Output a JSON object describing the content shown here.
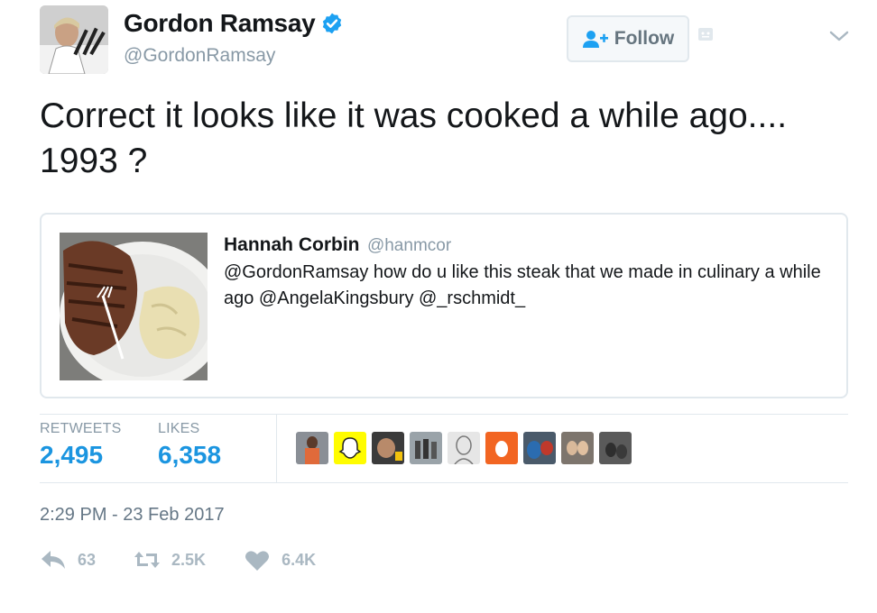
{
  "author": {
    "display_name": "Gordon Ramsay",
    "handle": "@GordonRamsay",
    "verified": true
  },
  "follow_button": {
    "label": "Follow"
  },
  "tweet": {
    "text": "Correct it looks like it was cooked a while ago.... 1993 ?"
  },
  "quoted_tweet": {
    "display_name": "Hannah Corbin",
    "handle": "@hanmcor",
    "text": "@GordonRamsay how do u like this steak that we made in culinary a while ago @AngelaKingsbury @_rschmidt_"
  },
  "stats": {
    "retweets_label": "RETWEETS",
    "retweets_value": "2,495",
    "likes_label": "LIKES",
    "likes_value": "6,358"
  },
  "timestamp": "2:29 PM - 23 Feb 2017",
  "actions": {
    "reply_count": "63",
    "retweet_count": "2.5K",
    "like_count": "6.4K"
  },
  "colors": {
    "link_blue": "#1b95e0",
    "verified_blue": "#1da1f2",
    "muted_gray": "#8899a6"
  },
  "icons": [
    "verified-icon",
    "follow-user-icon",
    "ghost-icon",
    "chevron-down-icon",
    "reply-icon",
    "retweet-icon",
    "heart-icon"
  ]
}
